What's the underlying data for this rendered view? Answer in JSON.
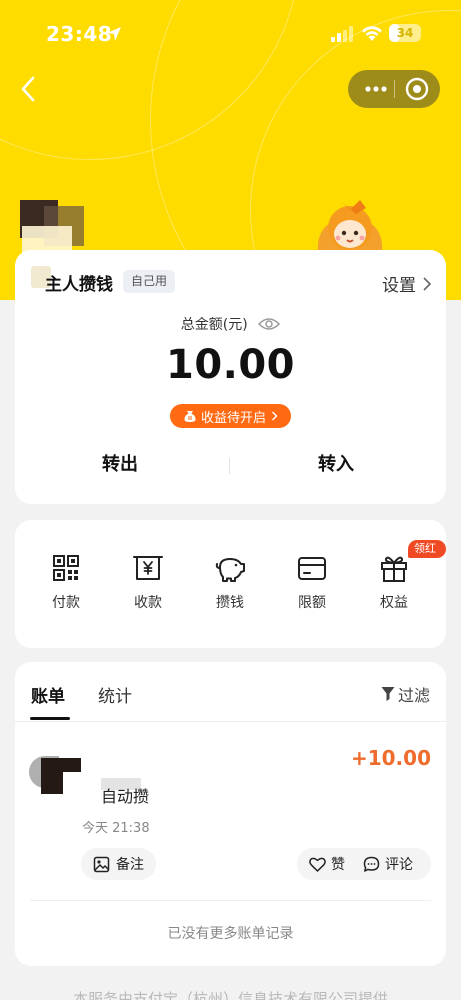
{
  "status_bar": {
    "time": "23:48",
    "battery": "34",
    "battery_level": 0.34,
    "icons": [
      "location-arrow-icon",
      "signal-icon",
      "wifi-icon",
      "battery-icon"
    ]
  },
  "nav": {
    "back_icon": "chevron-left-icon",
    "capsule_icons": [
      "more-dots-icon",
      "close-target-icon"
    ]
  },
  "colors": {
    "hero_yellow": "#ffdc00",
    "accent_orange": "#ff6a13",
    "amount_orange": "#ef6c2c",
    "badge_red": "#f04a25",
    "capsule": "#9e8c1a"
  },
  "jar": {
    "name": "主人攒钱",
    "tag": "自己用",
    "settings_label": "设置",
    "total_label": "总金额(元)",
    "amount": "10.00",
    "earnings_label": "收益待开启",
    "transfer_out": "转出",
    "transfer_in": "转入"
  },
  "tools": {
    "items": [
      {
        "label": "付款",
        "icon": "qrcode-icon"
      },
      {
        "label": "收款",
        "icon": "yuan-receipt-icon"
      },
      {
        "label": "攒钱",
        "icon": "piggy-bank-icon"
      },
      {
        "label": "限额",
        "icon": "card-icon"
      },
      {
        "label": "权益",
        "icon": "gift-icon"
      }
    ],
    "badge": "领红包"
  },
  "bills": {
    "tabs": [
      "账单",
      "统计"
    ],
    "active_tab": "账单",
    "filter_label": "过滤",
    "items": [
      {
        "title": "自动攒",
        "time": "今天 21:38",
        "amount": "+10.00",
        "note_label": "备注",
        "like_label": "赞",
        "comment_label": "评论"
      }
    ],
    "empty_text": "已没有更多账单记录"
  },
  "footer": {
    "text": "本服务由支付宝（杭州）信息技术有限公司提供"
  }
}
